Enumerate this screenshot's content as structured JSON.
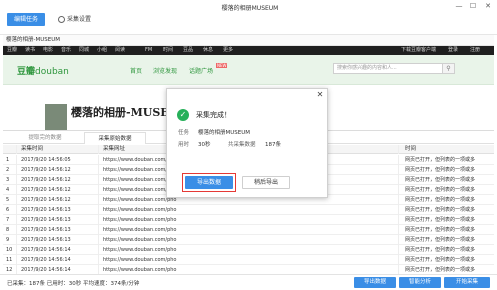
{
  "toolbar": {
    "edit_task": "编辑任务",
    "settings": "采集设置"
  },
  "window": {
    "title": "樱落的相册MUSEUM",
    "minimize": "—",
    "maximize": "☐",
    "close": "✕"
  },
  "url_bar": "樱落的相册-MUSEUM",
  "douban": {
    "nav": [
      "豆瓣",
      "读书",
      "电影",
      "音乐",
      "同城",
      "小组",
      "阅读",
      "FM",
      "时间",
      "豆品",
      "休息",
      "更多"
    ],
    "download_app": "下载豆瓣客户端",
    "login": "登录",
    "register": "注册",
    "logo_cn": "豆瓣",
    "logo_en": "douban",
    "links": [
      "首页",
      "浏览发现",
      "话题广场"
    ],
    "new_badge": "NEW",
    "search_placeholder": "搜索你感兴趣的内容和人...",
    "search_icon": "search-icon",
    "album_title": "樱落的相册-MUSEUM"
  },
  "tabs": {
    "tab1": "提取完的数据",
    "tab2": "采集原始数据"
  },
  "table": {
    "headers": [
      "",
      "采集时间",
      "采集网址",
      "时间"
    ],
    "rows": [
      [
        "1",
        "2017/9/20 14:56:05",
        "https://www.douban.com/pho",
        "网页已打开，但列表的一项或多"
      ],
      [
        "2",
        "2017/9/20 14:56:12",
        "https://www.douban.com/pho",
        "网页已打开，但列表的一项或多"
      ],
      [
        "3",
        "2017/9/20 14:56:12",
        "https://www.douban.com/pho",
        "网页已打开，但列表的一项或多"
      ],
      [
        "4",
        "2017/9/20 14:56:12",
        "https://www.douban.com/pho",
        "网页已打开，但列表的一项或多"
      ],
      [
        "5",
        "2017/9/20 14:56:12",
        "https://www.douban.com/pho",
        "网页已打开，但列表的一项或多"
      ],
      [
        "6",
        "2017/9/20 14:56:13",
        "https://www.douban.com/pho",
        "网页已打开，但列表的一项或多"
      ],
      [
        "7",
        "2017/9/20 14:56:13",
        "https://www.douban.com/pho",
        "网页已打开，但列表的一项或多"
      ],
      [
        "8",
        "2017/9/20 14:56:13",
        "https://www.douban.com/pho",
        "网页已打开，但列表的一项或多"
      ],
      [
        "9",
        "2017/9/20 14:56:13",
        "https://www.douban.com/pho",
        "网页已打开，但列表的一项或多"
      ],
      [
        "10",
        "2017/9/20 14:56:14",
        "https://www.douban.com/pho",
        "网页已打开，但列表的一项或多"
      ],
      [
        "11",
        "2017/9/20 14:56:14",
        "https://www.douban.com/pho",
        "网页已打开，但列表的一项或多"
      ],
      [
        "12",
        "2017/9/20 14:56:14",
        "https://www.douban.com/pho",
        "网页已打开，但列表的一项或多"
      ]
    ]
  },
  "modal": {
    "title": "采集完成！",
    "task_label": "任务",
    "task_value": "樱落的相册MUSEUM",
    "time_label": "用时",
    "time_value": "30秒",
    "count_label": "共采集数据",
    "count_value": "187条",
    "export_button": "导出数据",
    "later_button": "稍后导出",
    "close": "✕"
  },
  "status": {
    "text": "已采集：187条  已用时：30秒  平均速度：374条/分钟",
    "export": "导出数据",
    "analyze": "智能分析",
    "start": "开始采集"
  },
  "colors": {
    "accent": "#3a8ee6",
    "douban_green": "#2e963d",
    "success": "#27b05a",
    "highlight": "#e53935"
  }
}
